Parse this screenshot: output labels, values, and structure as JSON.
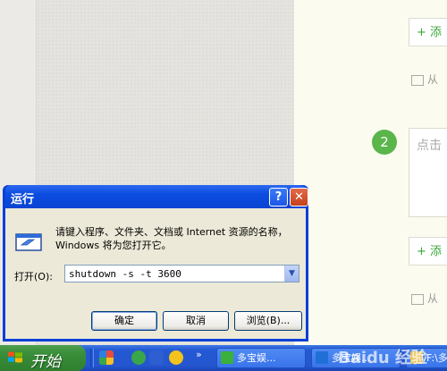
{
  "background": {
    "add_step_label": "+ 添",
    "add_image_label": "从",
    "step_number": "2",
    "text_placeholder": "点击"
  },
  "dialog": {
    "title": "运行",
    "help_glyph": "?",
    "close_glyph": "✕",
    "prompt": "请键入程序、文件夹、文档或 Internet 资源的名称，Windows 将为您打开它。",
    "open_label": "打开(O):",
    "command_value": "shutdown -s -t 3600",
    "ok_label": "确定",
    "cancel_label": "取消",
    "browse_label": "浏览(B)..."
  },
  "taskbar": {
    "start_label": "开始",
    "chevron": "»",
    "tasks": [
      {
        "label": "多宝娱...",
        "icon_color": "#3bb03b"
      },
      {
        "label": "多宝娱...",
        "icon_color": "#1f6fd6"
      },
      {
        "label": "F:\\多",
        "icon_color": "#e8c25a"
      }
    ],
    "watermark": "Baidu 经验"
  },
  "colors": {
    "accent_green": "#5ab54b",
    "titlebar_blue": "#0a44d2",
    "taskbar_blue": "#2458d3",
    "start_green": "#3a8f3a"
  }
}
